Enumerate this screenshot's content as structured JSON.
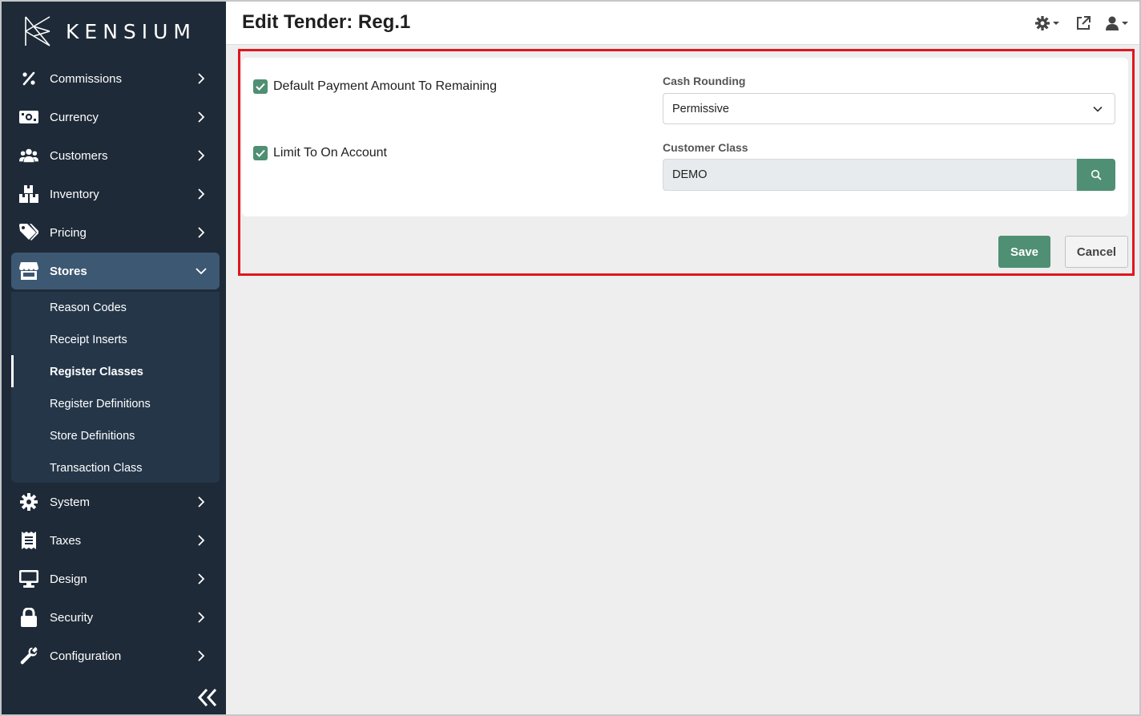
{
  "brand": {
    "name": "KENSIUM"
  },
  "header": {
    "title": "Edit Tender: Reg.1"
  },
  "sidebar": {
    "items": [
      {
        "label": "Commissions",
        "icon": "percent-icon"
      },
      {
        "label": "Currency",
        "icon": "money-bill-icon"
      },
      {
        "label": "Customers",
        "icon": "users-icon"
      },
      {
        "label": "Inventory",
        "icon": "boxes-icon"
      },
      {
        "label": "Pricing",
        "icon": "tags-icon"
      },
      {
        "label": "Stores",
        "icon": "store-icon",
        "expanded": true
      },
      {
        "label": "System",
        "icon": "gear-icon"
      },
      {
        "label": "Taxes",
        "icon": "receipt-icon"
      },
      {
        "label": "Design",
        "icon": "monitor-icon"
      },
      {
        "label": "Security",
        "icon": "lock-icon"
      },
      {
        "label": "Configuration",
        "icon": "wrench-icon"
      }
    ],
    "stores_subitems": [
      {
        "label": "Reason Codes"
      },
      {
        "label": "Receipt Inserts"
      },
      {
        "label": "Register Classes",
        "current": true
      },
      {
        "label": "Register Definitions"
      },
      {
        "label": "Store Definitions"
      },
      {
        "label": "Transaction Class"
      }
    ]
  },
  "form": {
    "default_payment": {
      "label": "Default Payment Amount To Remaining",
      "checked": true
    },
    "limit_to_on_account": {
      "label": "Limit To On Account",
      "checked": true
    },
    "cash_rounding": {
      "label": "Cash Rounding",
      "value": "Permissive"
    },
    "customer_class": {
      "label": "Customer Class",
      "value": "DEMO"
    }
  },
  "actions": {
    "save": "Save",
    "cancel": "Cancel"
  },
  "colors": {
    "sidebar_bg": "#1e2a38",
    "accent": "#4f8f73",
    "active_nav": "#3d5872",
    "highlight": "#e0161f"
  }
}
